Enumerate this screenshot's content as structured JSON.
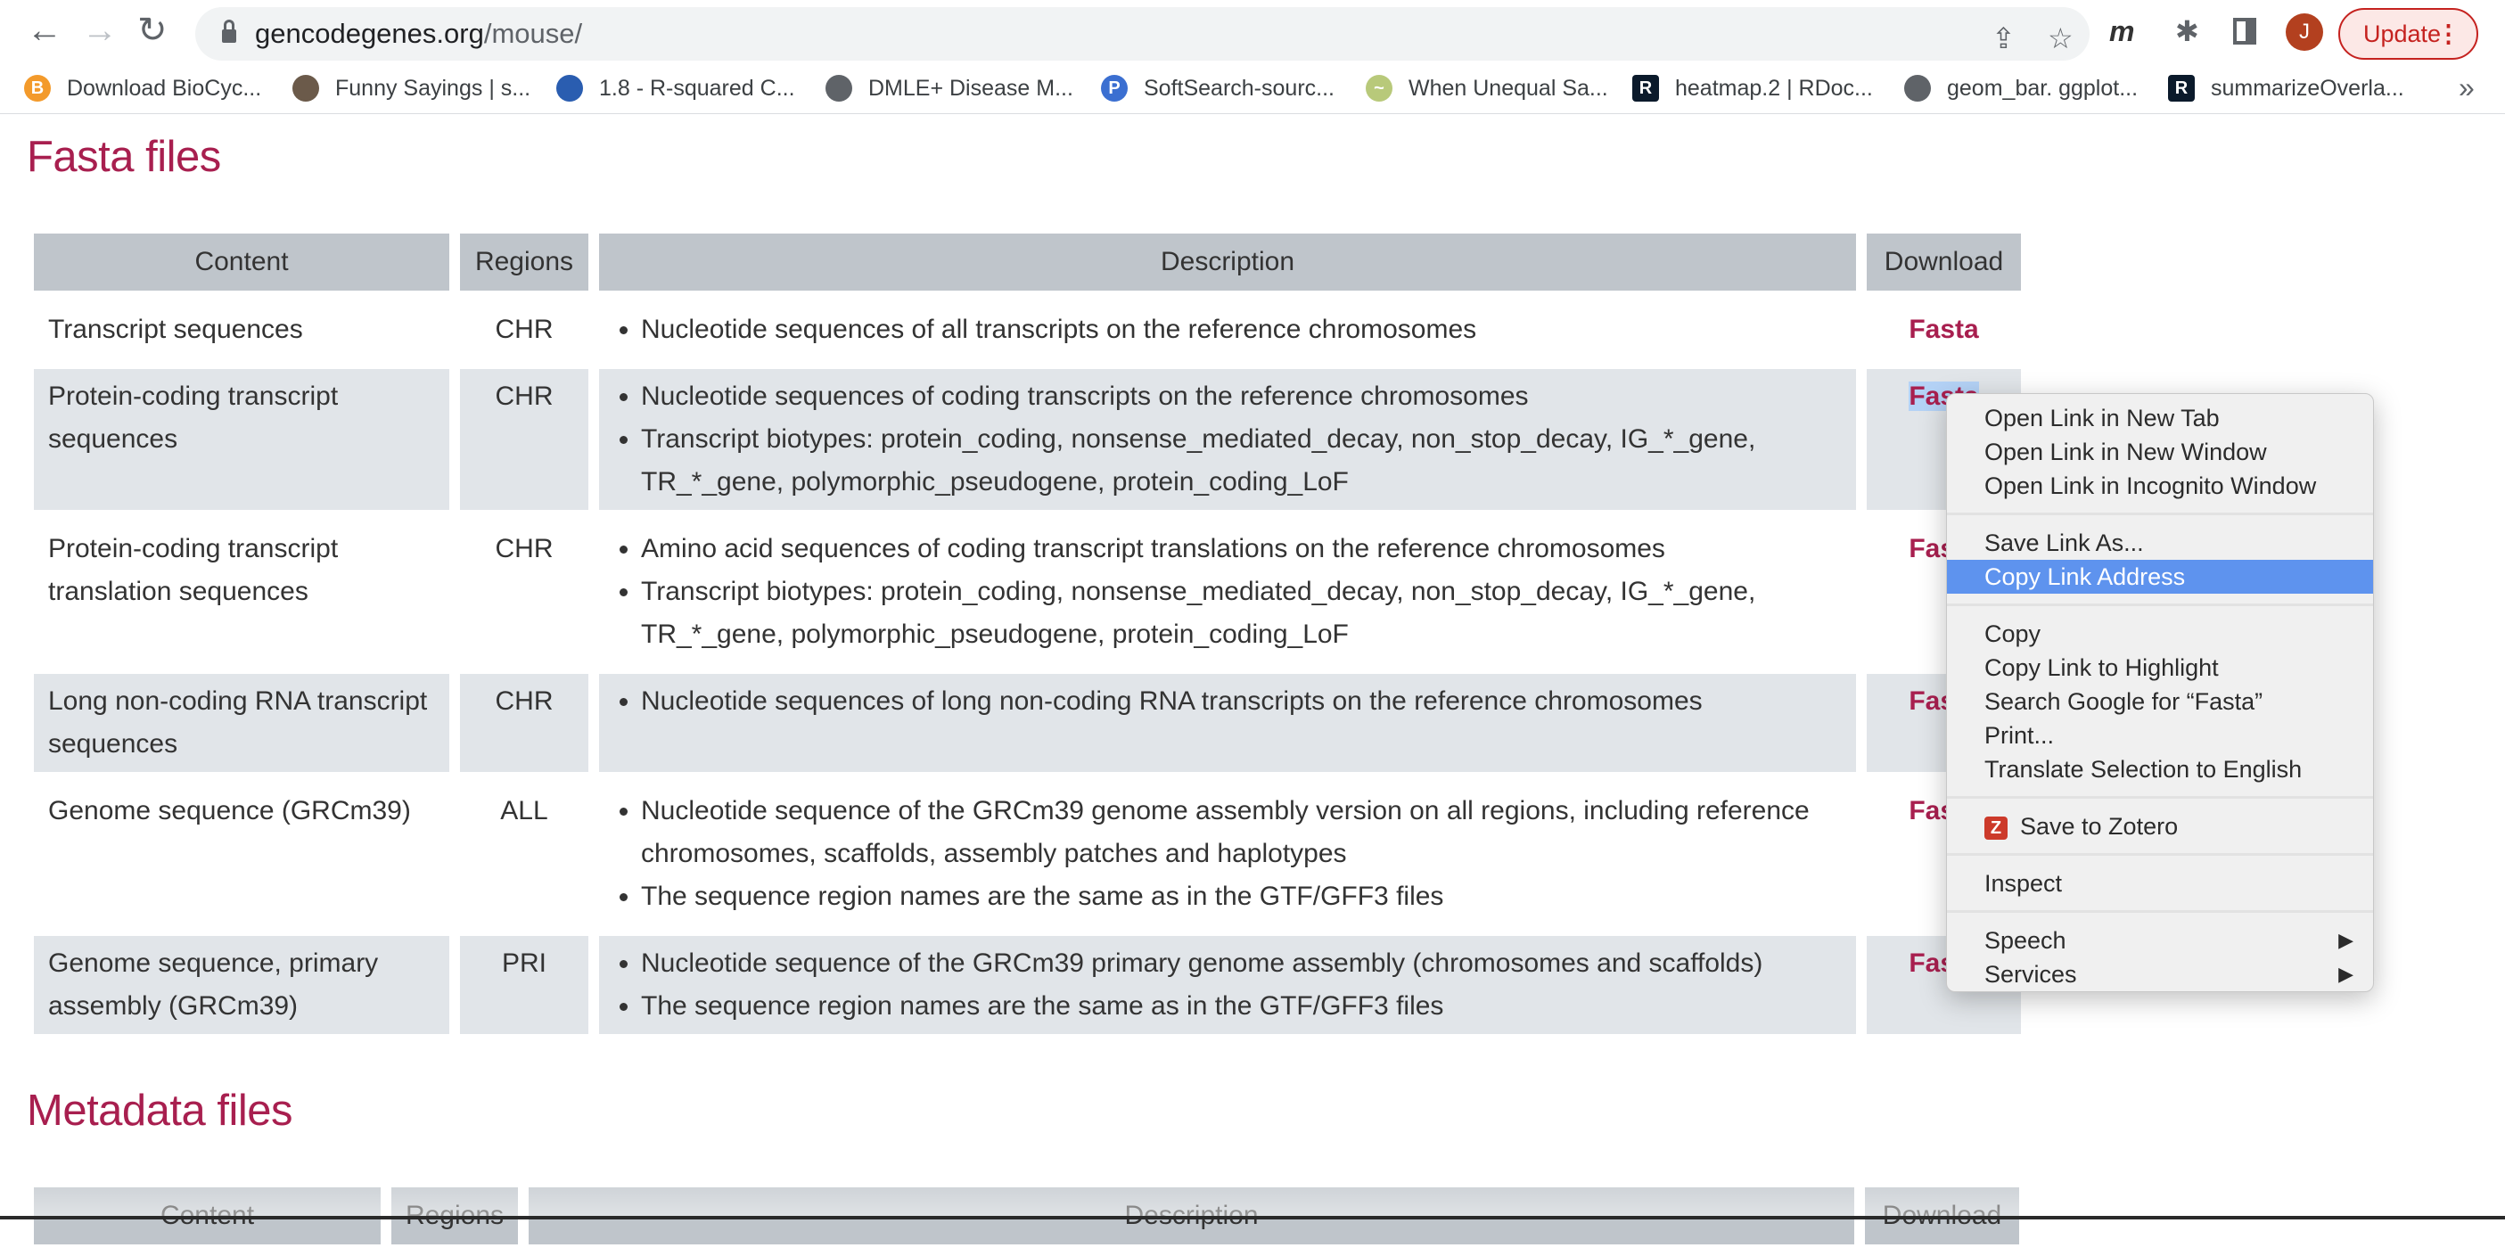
{
  "browser": {
    "url_host": "gencodegenes.org",
    "url_path": "/mouse/",
    "avatar_letter": "J",
    "update_label": "Update",
    "bookmarks": [
      {
        "label": "Download BioCyc...",
        "icon": "biocyc-icon",
        "color": "#f39a2b",
        "glyph": "B"
      },
      {
        "label": "Funny Sayings | s...",
        "icon": "photo-icon",
        "color": "#6b5a4a",
        "glyph": ""
      },
      {
        "label": "1.8 - R-squared C...",
        "icon": "shield-icon",
        "color": "#2a5db0",
        "glyph": ""
      },
      {
        "label": "DMLE+ Disease M...",
        "icon": "globe-icon",
        "color": "#5f6368",
        "glyph": ""
      },
      {
        "label": "SoftSearch-sourc...",
        "icon": "house-icon",
        "color": "#3b6fd1",
        "glyph": "P"
      },
      {
        "label": "When Unequal Sa...",
        "icon": "chart-icon",
        "color": "#b8c97a",
        "glyph": "~"
      },
      {
        "label": "heatmap.2 | RDoc...",
        "icon": "r-icon",
        "color": "#0b1a2b",
        "glyph": "R"
      },
      {
        "label": "geom_bar. ggplot...",
        "icon": "globe-icon",
        "color": "#5f6368",
        "glyph": ""
      },
      {
        "label": "summarizeOverla...",
        "icon": "r-icon",
        "color": "#0b1a2b",
        "glyph": "R"
      }
    ],
    "more_label": "»"
  },
  "fasta": {
    "title": "Fasta files",
    "headers": [
      "Content",
      "Regions",
      "Description",
      "Download"
    ],
    "rows": [
      {
        "content": "Transcript sequences",
        "regions": "CHR",
        "description": [
          "Nucleotide sequences of all transcripts on the reference chromosomes"
        ],
        "download": "Fasta"
      },
      {
        "content": "Protein-coding transcript sequences",
        "regions": "CHR",
        "description": [
          "Nucleotide sequences of coding transcripts on the reference chromosomes",
          "Transcript biotypes: protein_coding, nonsense_mediated_decay, non_stop_decay, IG_*_gene, TR_*_gene, polymorphic_pseudogene, protein_coding_LoF"
        ],
        "download": "Fasta",
        "selected": true
      },
      {
        "content": "Protein-coding transcript translation sequences",
        "regions": "CHR",
        "description": [
          "Amino acid sequences of coding transcript translations on the reference chromosomes",
          "Transcript biotypes: protein_coding, nonsense_mediated_decay, non_stop_decay, IG_*_gene, TR_*_gene, polymorphic_pseudogene, protein_coding_LoF"
        ],
        "download": "Fasta"
      },
      {
        "content": "Long non-coding RNA transcript sequences",
        "regions": "CHR",
        "description": [
          "Nucleotide sequences of long non-coding RNA transcripts on the reference chromosomes"
        ],
        "download": "Fasta"
      },
      {
        "content": "Genome sequence (GRCm39)",
        "regions": "ALL",
        "description": [
          "Nucleotide sequence of the GRCm39 genome assembly version on all regions, including reference chromosomes, scaffolds, assembly patches and haplotypes",
          "The sequence region names are the same as in the GTF/GFF3 files"
        ],
        "download": "Fasta"
      },
      {
        "content": "Genome sequence, primary assembly (GRCm39)",
        "regions": "PRI",
        "description": [
          "Nucleotide sequence of the GRCm39 primary genome assembly (chromosomes and scaffolds)",
          "The sequence region names are the same as in the GTF/GFF3 files"
        ],
        "download": "Fasta"
      }
    ]
  },
  "metadata": {
    "title": "Metadata files",
    "headers": [
      "Content",
      "Regions",
      "Description",
      "Download"
    ]
  },
  "context_menu": {
    "groups": [
      [
        "Open Link in New Tab",
        "Open Link in New Window",
        "Open Link in Incognito Window"
      ],
      [
        "Save Link As...",
        "Copy Link Address"
      ],
      [
        "Copy",
        "Copy Link to Highlight",
        "Search Google for “Fasta”",
        "Print...",
        "Translate Selection to English"
      ],
      [
        "Save to Zotero"
      ],
      [
        "Inspect"
      ],
      [
        "Speech",
        "Services"
      ]
    ],
    "highlighted": "Copy Link Address",
    "submenu_items": [
      "Speech",
      "Services"
    ]
  },
  "colors": {
    "accent": "#a81f4f",
    "header_bg": "#bfc5cb",
    "row_alt_bg": "#e1e5e9",
    "menu_highlight": "#5e93ee"
  }
}
